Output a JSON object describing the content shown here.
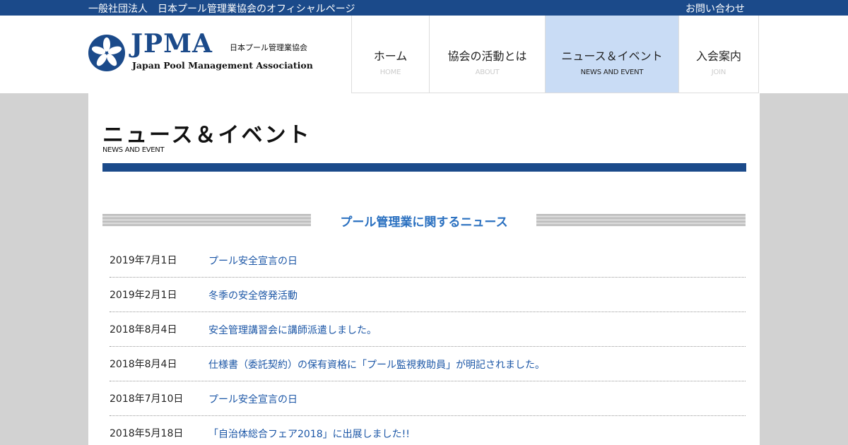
{
  "topbar": {
    "org_name": "一般社団法人　日本プール管理業協会のオフィシャルページ",
    "contact_link": "お問い合わせ"
  },
  "logo": {
    "acronym": "JPMA",
    "name_jp": "日本プール管理業協会",
    "name_en": "Japan Pool Management Association"
  },
  "nav": {
    "items": [
      {
        "jp": "ホーム",
        "en": "HOME",
        "active": false
      },
      {
        "jp": "協会の活動とは",
        "en": "ABOUT",
        "active": false
      },
      {
        "jp": "ニュース＆イベント",
        "en": "NEWS AND EVENT",
        "active": true
      },
      {
        "jp": "入会案内",
        "en": "JOIN",
        "active": false
      }
    ]
  },
  "page": {
    "title": "ニュース＆イベント",
    "subtitle": "NEWS AND EVENT"
  },
  "news_section": {
    "heading": "プール管理業に関するニュース",
    "items": [
      {
        "date": "2019年7月1日",
        "title": "プール安全宣言の日"
      },
      {
        "date": "2019年2月1日",
        "title": "冬季の安全啓発活動"
      },
      {
        "date": "2018年8月4日",
        "title": "安全管理講習会に講師派遣しました。"
      },
      {
        "date": "2018年8月4日",
        "title": "仕様書（委託契約）の保有資格に「プール監視救助員」が明記されました。"
      },
      {
        "date": "2018年7月10日",
        "title": "プール安全宣言の日"
      },
      {
        "date": "2018年5月18日",
        "title": "「自治体総合フェア2018」に出展しました!!"
      }
    ]
  },
  "colors": {
    "brand_blue": "#1b4a8a",
    "link_blue": "#1b56a6",
    "nav_active_bg": "#c9dcf5",
    "page_bg": "#d2d2d2"
  }
}
